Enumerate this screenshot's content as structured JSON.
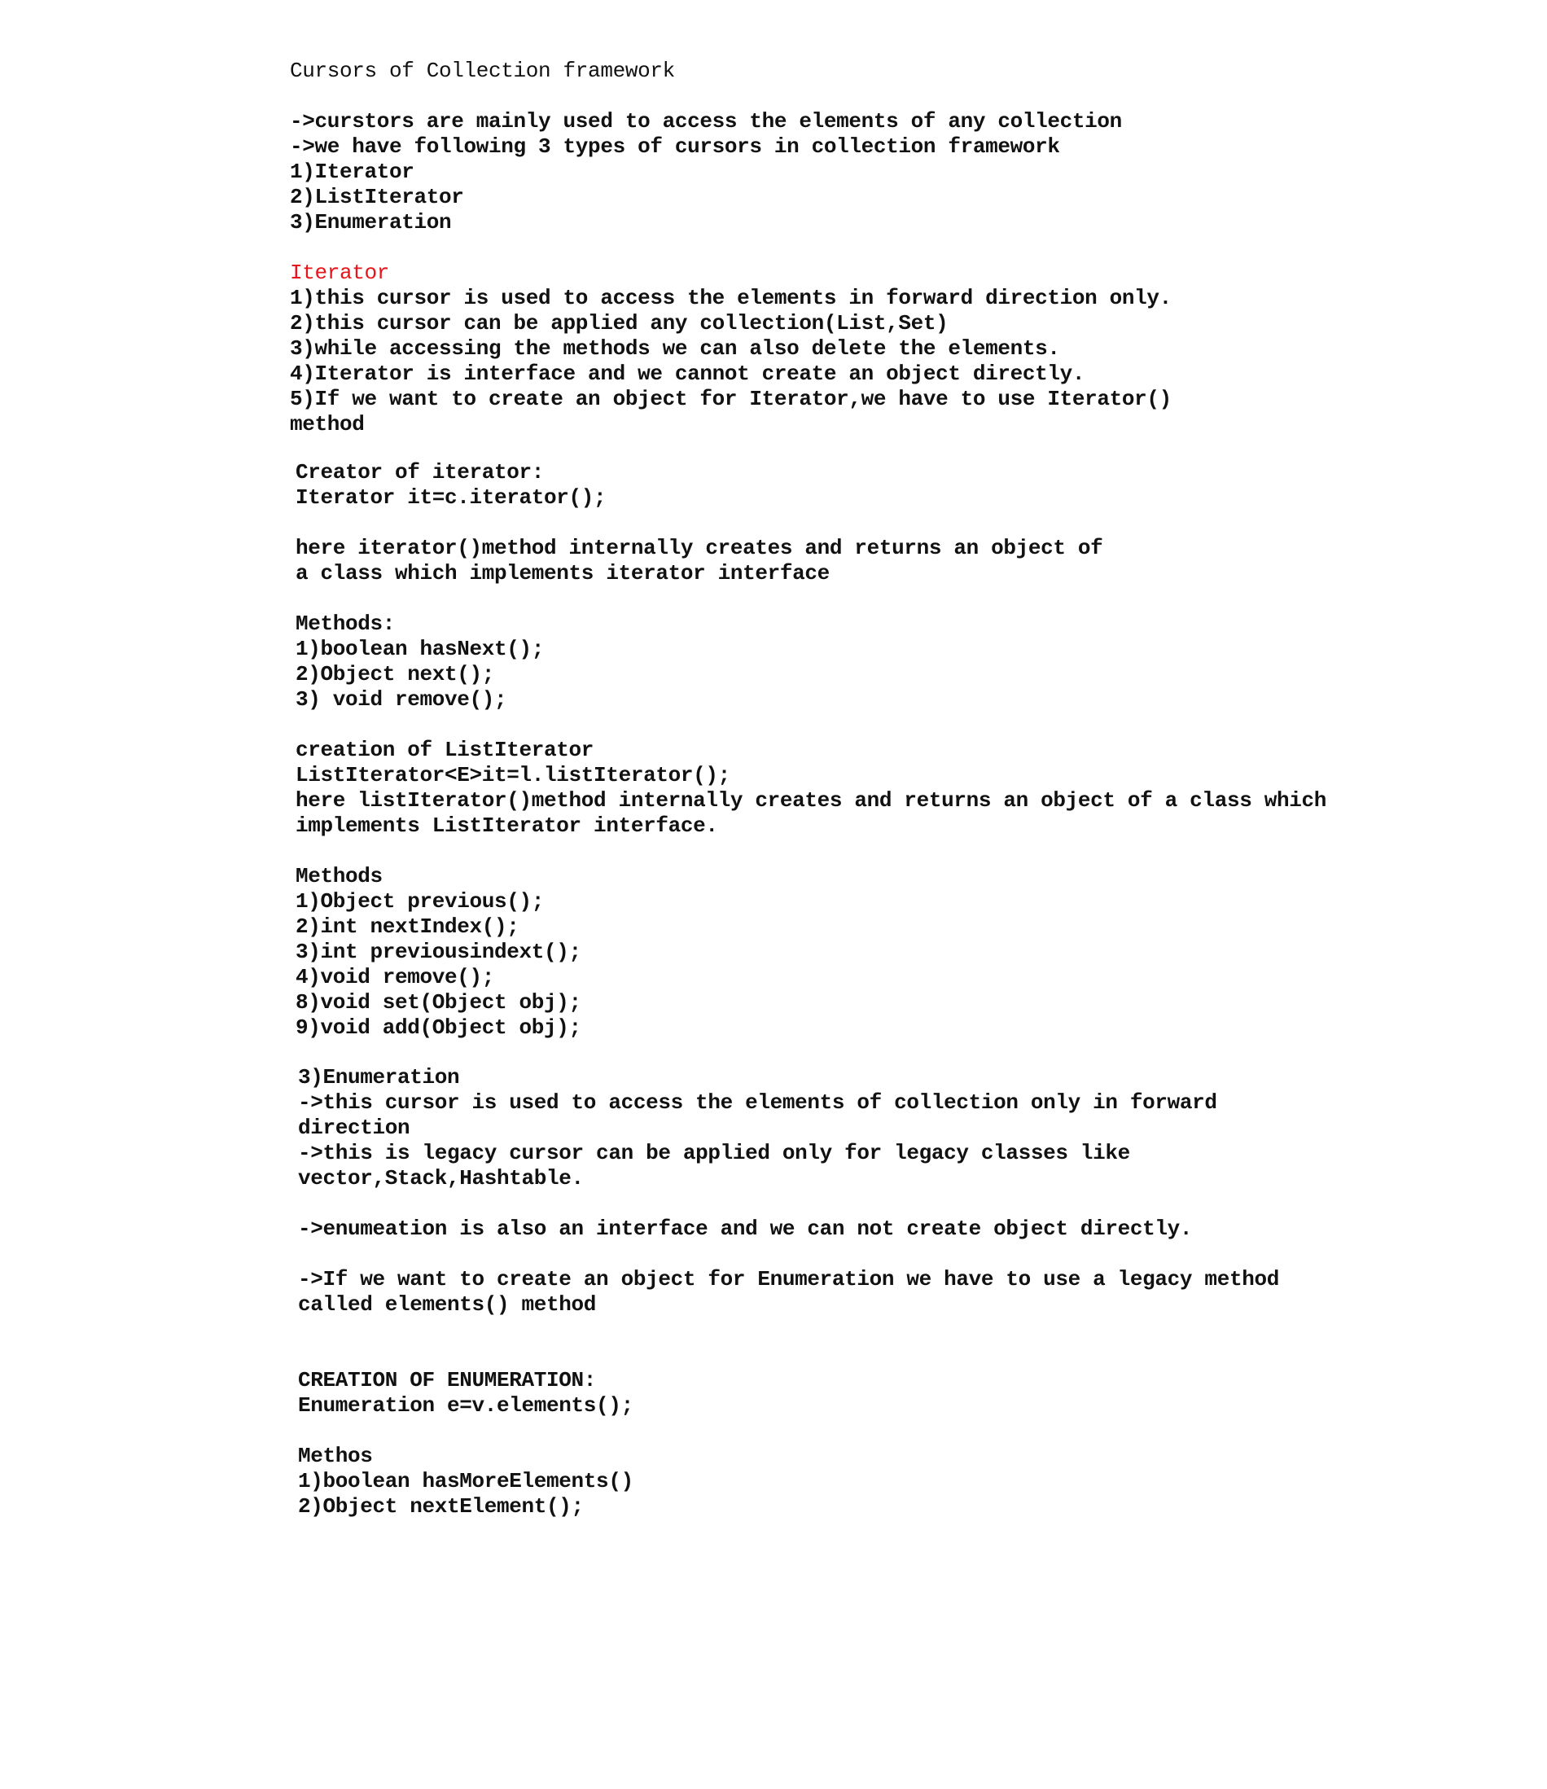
{
  "document": {
    "title": "Cursors of Collection framework",
    "intro": [
      "->curstors are mainly used to access the elements of any collection",
      "->we have following 3 types of cursors in collection framework",
      "1)Iterator",
      "2)ListIterator",
      "3)Enumeration"
    ],
    "iterator": {
      "heading": "Iterator",
      "heading_color": "#e8141b",
      "points": [
        "1)this cursor is used to access the elements in forward direction only.",
        "2)this cursor can be applied any collection(List,Set)",
        "3)while accessing the methods we can also delete the elements.",
        "4)Iterator is interface and we cannot create an object directly.",
        "5)If we want to create an object for Iterator,we have to use Iterator()",
        "method"
      ],
      "creation": [
        "Creator of iterator:",
        "Iterator it=c.iterator();"
      ],
      "explanation": [
        "here iterator()method internally creates and returns an object of",
        "a class which implements iterator interface"
      ],
      "methods": [
        "Methods:",
        "1)boolean hasNext();",
        "2)Object next();",
        "3) void remove();"
      ]
    },
    "list_iterator": {
      "creation": [
        "creation of ListIterator",
        "ListIterator<E>it=l.listIterator();",
        "here listIterator()method internally creates and returns an object of a class which",
        "implements ListIterator interface."
      ],
      "methods": [
        "Methods",
        "1)Object previous();",
        "2)int nextIndex();",
        "3)int previousindext();",
        "4)void remove();",
        "8)void set(Object obj);",
        "9)void add(Object obj);"
      ]
    },
    "enumeration": {
      "points": [
        "3)Enumeration",
        "->this cursor is used to access the elements of collection only in forward",
        "direction",
        "->this is legacy cursor can be applied only for legacy classes like",
        "vector,Stack,Hashtable."
      ],
      "interface_note": "->enumeation is also an interface and we can not create object directly.",
      "create_note": [
        "->If we want to create an object for Enumeration we have to use a legacy method",
        "called elements() method"
      ],
      "creation": [
        "CREATION OF ENUMERATION:",
        "Enumeration e=v.elements();"
      ],
      "methods": [
        "Methos",
        "1)boolean hasMoreElements()",
        "2)Object nextElement();"
      ]
    }
  }
}
